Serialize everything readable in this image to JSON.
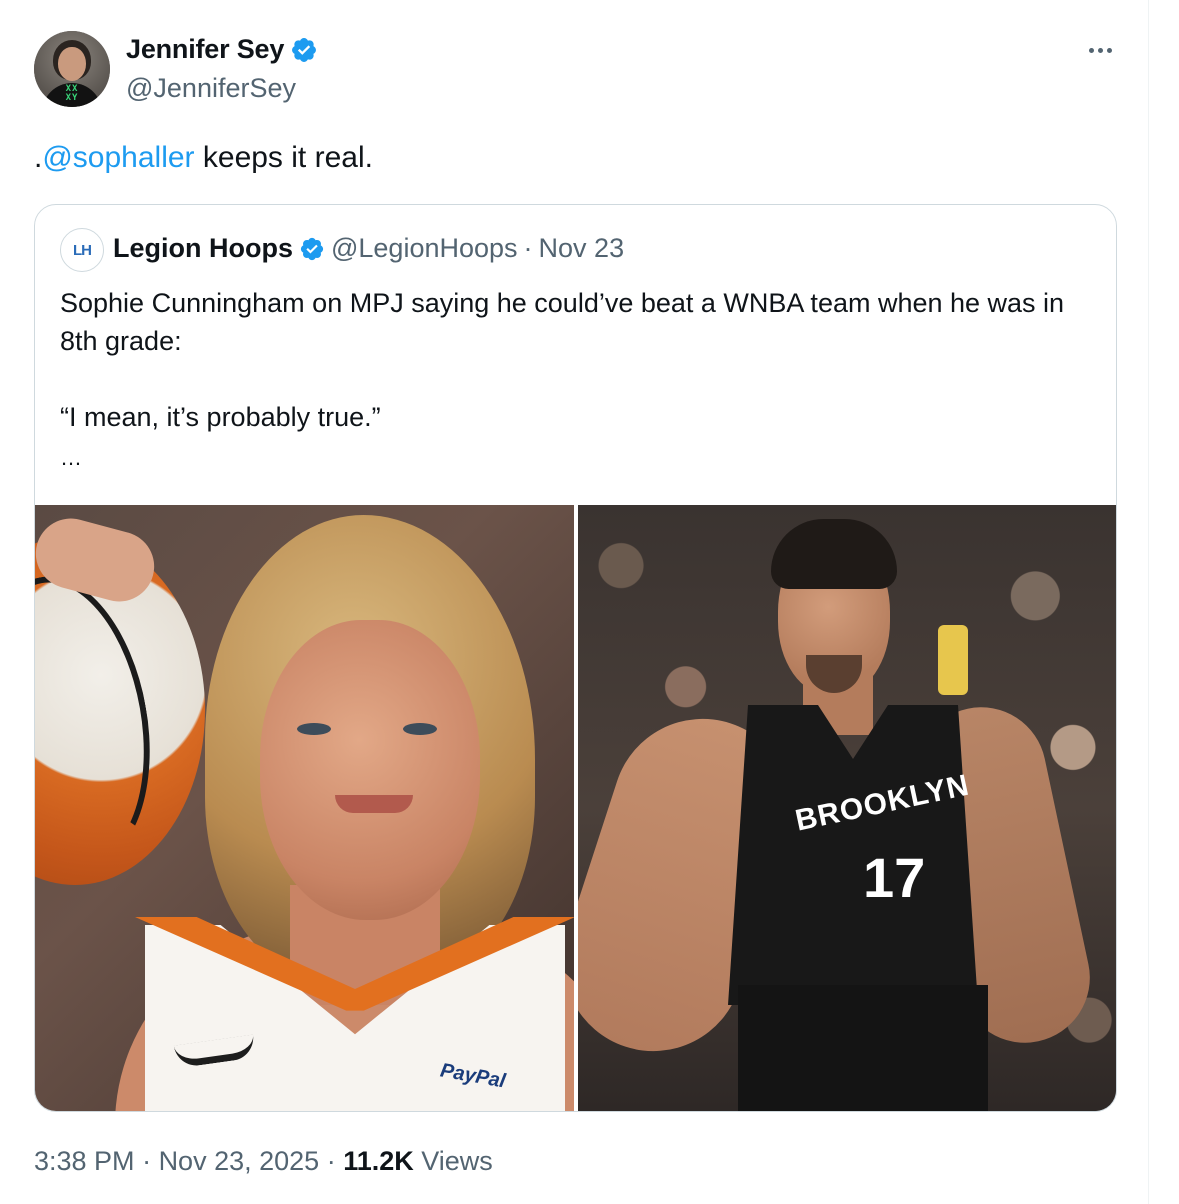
{
  "author": {
    "display_name": "Jennifer Sey",
    "handle": "@JenniferSey",
    "verified": true,
    "avatar_shirt_text": "XX XY"
  },
  "tweet": {
    "prefix": ".",
    "mention": "@sophaller",
    "text": " keeps it real."
  },
  "quoted": {
    "display_name": "Legion Hoops",
    "handle": "@LegionHoops",
    "separator": "·",
    "date": "Nov 23",
    "avatar_text": "LH",
    "body_line1": "Sophie Cunningham on MPJ saying he could’ve beat a WNBA team when he was in 8th grade:",
    "body_line2": "“I mean, it’s probably true.”",
    "ellipsis": "…",
    "images": {
      "left_jersey_sponsor": "PayPal",
      "right_jersey_team": "BROOKLYN",
      "right_jersey_number": "17"
    }
  },
  "footer": {
    "time": "3:38 PM",
    "sep1": " · ",
    "date": "Nov 23, 2025",
    "sep2": " · ",
    "views_count": "11.2K",
    "views_label": " Views"
  },
  "colors": {
    "verified_blue": "#1d9bf0",
    "text_primary": "#0f1419",
    "text_secondary": "#536471",
    "border": "#cfd9de"
  }
}
